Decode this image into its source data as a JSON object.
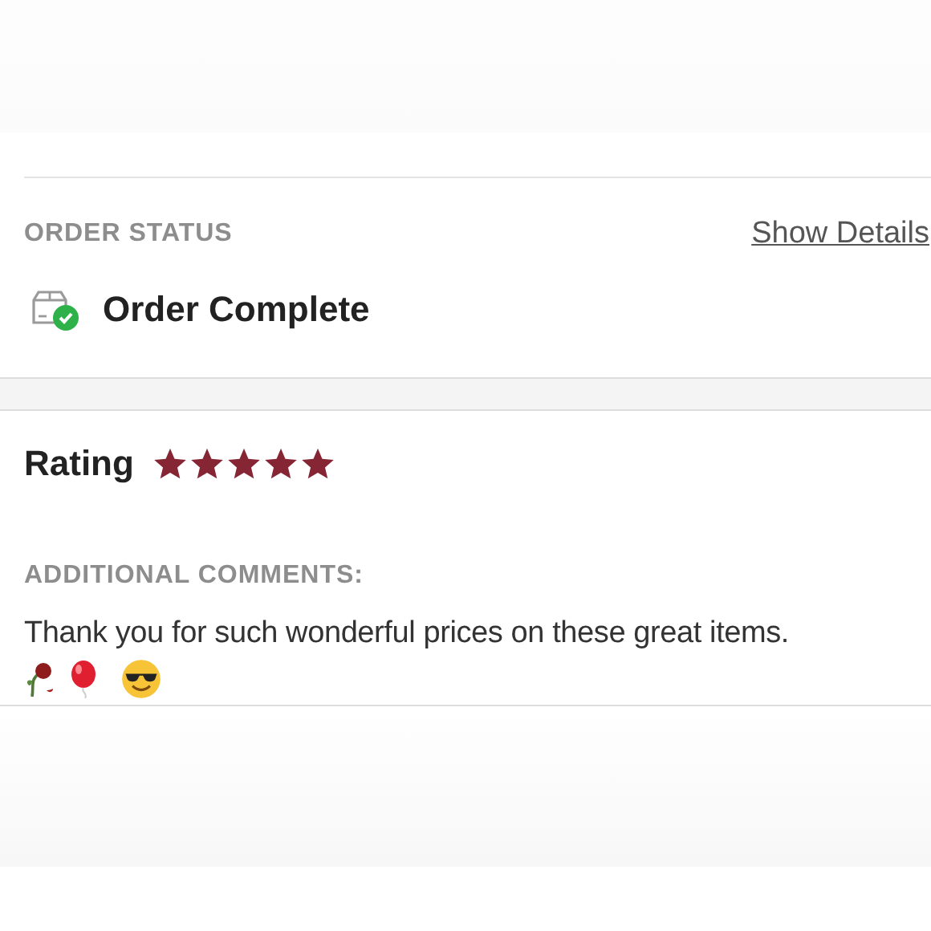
{
  "order_status": {
    "heading": "ORDER STATUS",
    "details_link": "Show Details",
    "status": "Order Complete",
    "complete": true
  },
  "rating": {
    "label": "Rating",
    "stars": 5
  },
  "comments": {
    "heading": "ADDITIONAL COMMENTS:",
    "text": "Thank you for such wonderful prices on these great items."
  }
}
